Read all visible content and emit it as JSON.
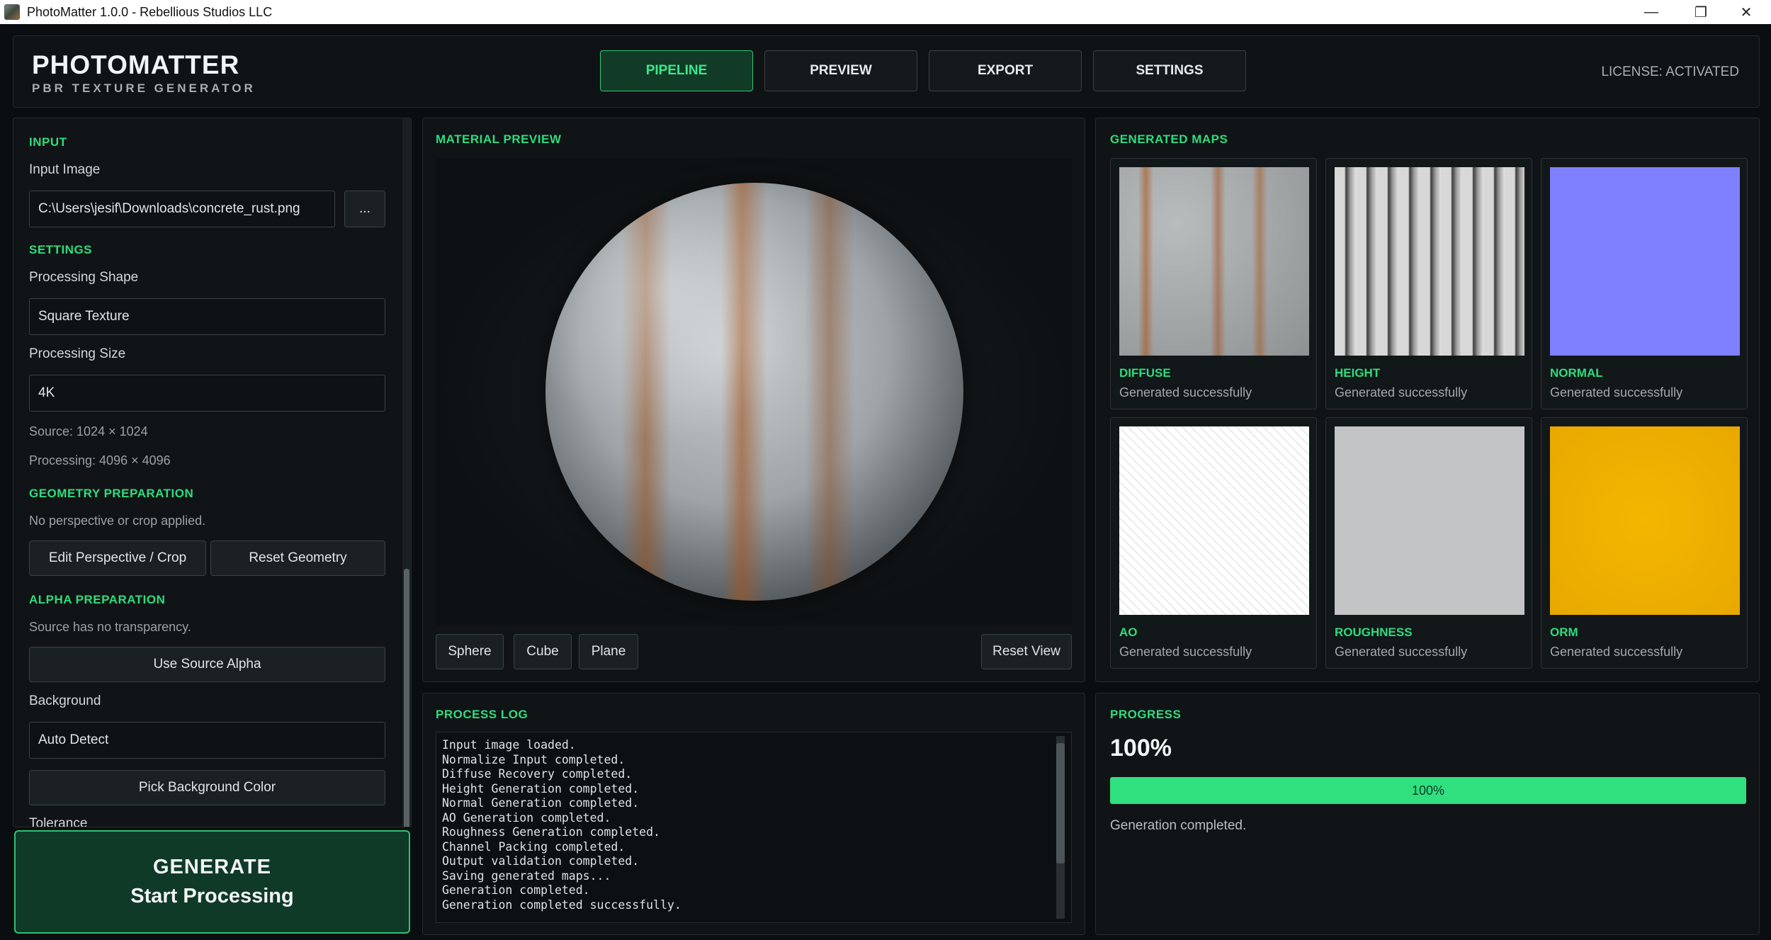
{
  "window": {
    "title": "PhotoMatter 1.0.0 - Rebellious Studios LLC"
  },
  "brand": {
    "name": "PHOTOMATTER",
    "subtitle": "PBR TEXTURE GENERATOR"
  },
  "nav": {
    "tabs": [
      "PIPELINE",
      "PREVIEW",
      "EXPORT",
      "SETTINGS"
    ],
    "active": "PIPELINE"
  },
  "license": "LICENSE: ACTIVATED",
  "input": {
    "section": "INPUT",
    "label": "Input Image",
    "path": "C:\\Users\\jesif\\Downloads\\concrete_rust.png",
    "browse_label": "..."
  },
  "settings": {
    "section": "SETTINGS",
    "shape_label": "Processing Shape",
    "shape_value": "Square Texture",
    "size_label": "Processing Size",
    "size_value": "4K",
    "source_info": "Source: 1024 × 1024",
    "processing_info": "Processing: 4096 × 4096"
  },
  "geometry": {
    "section": "GEOMETRY PREPARATION",
    "status": "No perspective or crop applied.",
    "edit_label": "Edit Perspective / Crop",
    "reset_label": "Reset Geometry"
  },
  "alpha": {
    "section": "ALPHA PREPARATION",
    "status": "Source has no transparency.",
    "use_alpha_label": "Use Source Alpha",
    "background_label": "Background",
    "background_value": "Auto Detect",
    "pick_color_label": "Pick Background Color",
    "tolerance_label": "Tolerance"
  },
  "generate": {
    "line1": "GENERATE",
    "line2": "Start Processing"
  },
  "preview": {
    "section": "MATERIAL PREVIEW",
    "shapes": [
      "Sphere",
      "Cube",
      "Plane"
    ],
    "reset_label": "Reset View"
  },
  "maps": {
    "section": "GENERATED MAPS",
    "items": [
      {
        "name": "DIFFUSE",
        "status": "Generated successfully",
        "icon": "diffuse-map"
      },
      {
        "name": "HEIGHT",
        "status": "Generated successfully",
        "icon": "height-map"
      },
      {
        "name": "NORMAL",
        "status": "Generated successfully",
        "icon": "normal-map",
        "color": "#7f80ff"
      },
      {
        "name": "AO",
        "status": "Generated successfully",
        "icon": "ao-map"
      },
      {
        "name": "ROUGHNESS",
        "status": "Generated successfully",
        "icon": "roughness-map"
      },
      {
        "name": "ORM",
        "status": "Generated successfully",
        "icon": "orm-map",
        "color": "#f5b600"
      }
    ]
  },
  "log": {
    "section": "PROCESS LOG",
    "lines": [
      "Input image loaded.",
      "Normalize Input completed.",
      "Diffuse Recovery completed.",
      "Height Generation completed.",
      "Normal Generation completed.",
      "AO Generation completed.",
      "Roughness Generation completed.",
      "Channel Packing completed.",
      "Output validation completed.",
      "Saving generated maps...",
      "Generation completed.",
      "Generation completed successfully."
    ]
  },
  "progress": {
    "section": "PROGRESS",
    "percent_text": "100%",
    "value": 1.0,
    "bar_label": "100%",
    "status": "Generation completed."
  },
  "colors": {
    "accent": "#2fdc7e",
    "active_tab_bg": "#123b27",
    "progress_fill": "#30e07f"
  }
}
